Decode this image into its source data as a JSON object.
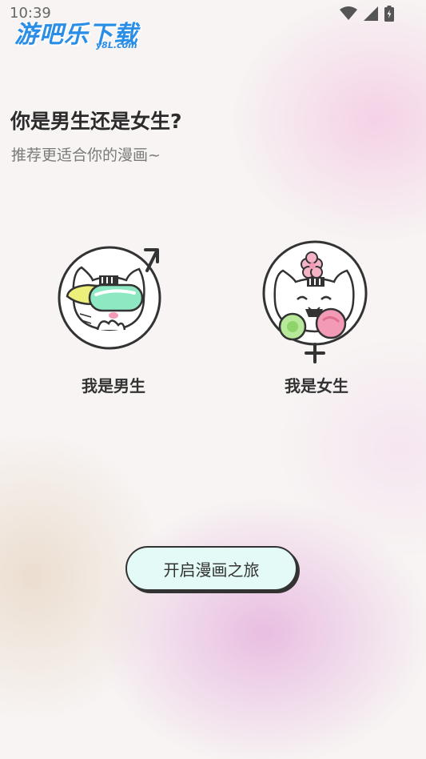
{
  "status_bar": {
    "time": "10:39",
    "icons": [
      "wifi-icon",
      "cellular-signal-icon",
      "battery-icon"
    ]
  },
  "watermark": {
    "main": "游吧乐下载",
    "sub": "y8L.com"
  },
  "header": {
    "title": "你是男生还是女生?",
    "subtitle": "推荐更适合你的漫画~"
  },
  "choices": [
    {
      "label": "我是男生",
      "icon": "male-symbol-icon",
      "avatar": "cat-with-cap-avatar"
    },
    {
      "label": "我是女生",
      "icon": "female-symbol-icon",
      "avatar": "cat-with-flowers-avatar"
    }
  ],
  "start_button": {
    "label": "开启漫画之旅"
  },
  "colors": {
    "button_bg": "#e3faf6",
    "outline": "#333333",
    "accent_green": "#8ee8c2",
    "accent_yellow": "#ecef7a",
    "accent_pink": "#f39bb6",
    "watermark_blue": "#2a8de6"
  }
}
